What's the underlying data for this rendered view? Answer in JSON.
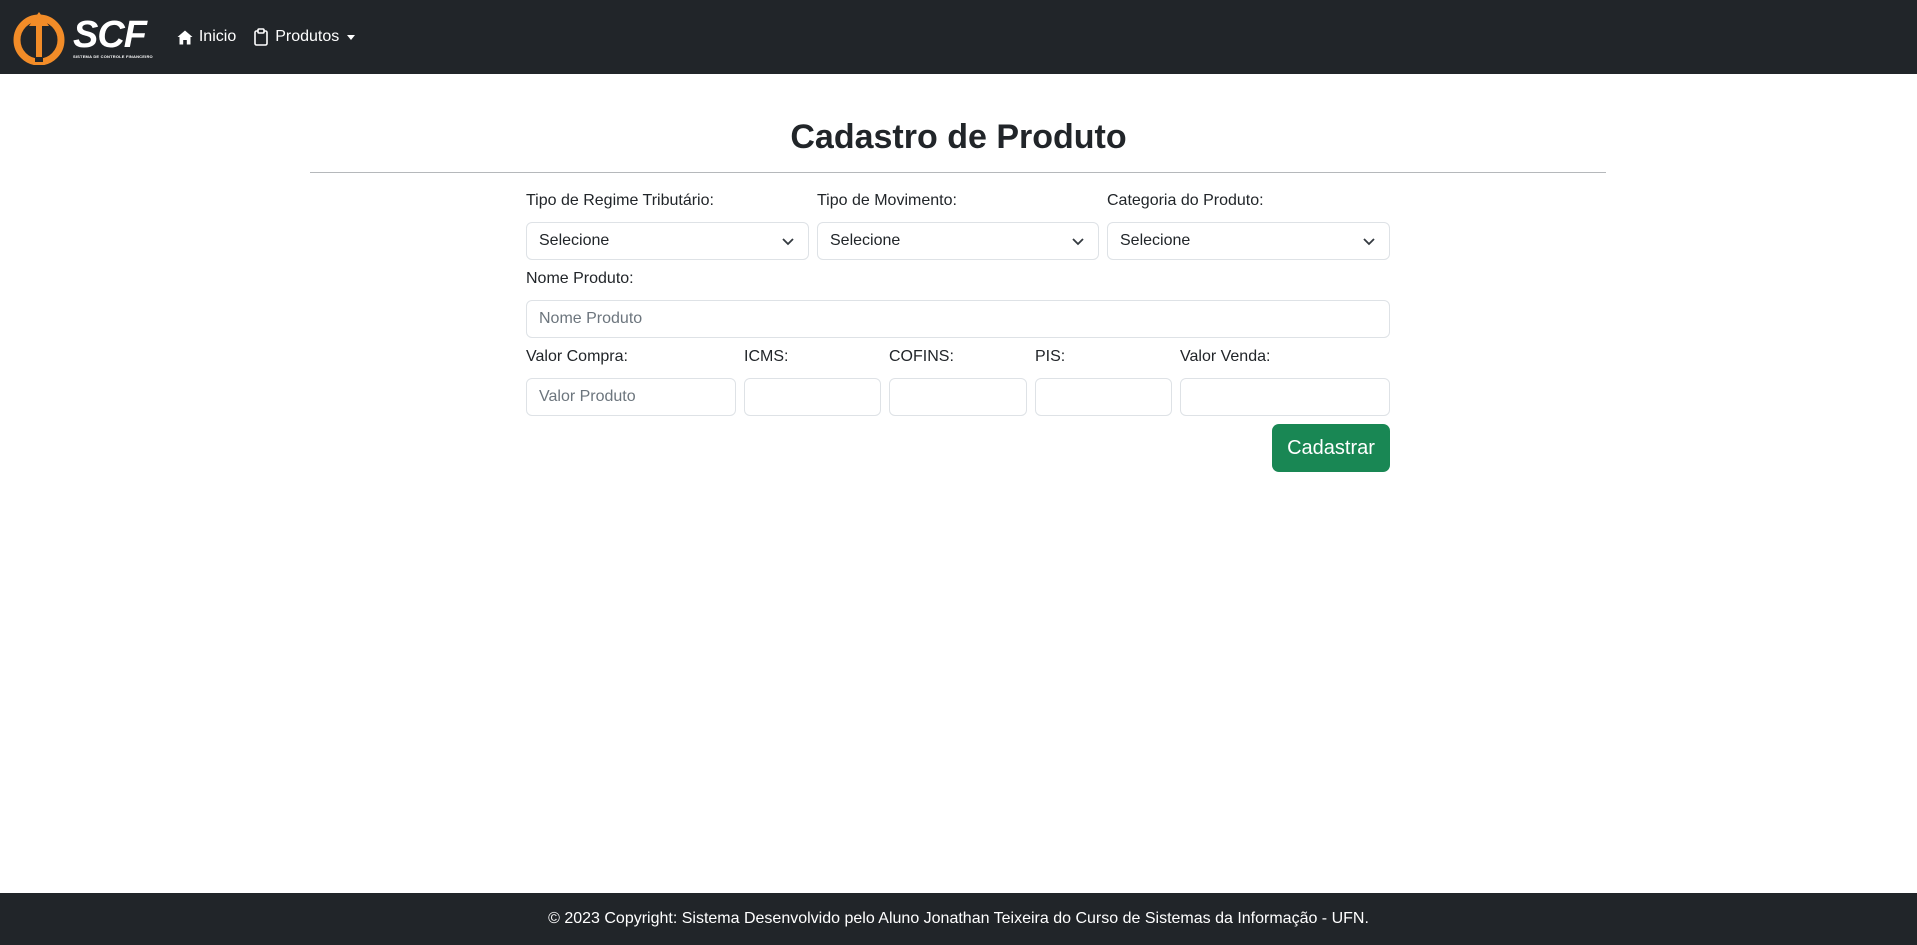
{
  "brand": {
    "name": "SCF",
    "tagline": "SISTEMA DE CONTROLE FINANCEIRO",
    "accent_color": "#f28c28"
  },
  "nav": {
    "home": {
      "label": "Inicio",
      "icon": "home-icon"
    },
    "products": {
      "label": "Produtos",
      "icon": "clipboard-icon"
    }
  },
  "page": {
    "title": "Cadastro de Produto"
  },
  "form": {
    "regime": {
      "label": "Tipo de Regime Tributário:",
      "value": "Selecione"
    },
    "movimento": {
      "label": "Tipo de Movimento:",
      "value": "Selecione"
    },
    "categoria": {
      "label": "Categoria do Produto:",
      "value": "Selecione"
    },
    "nome": {
      "label": "Nome Produto:",
      "placeholder": "Nome Produto",
      "value": ""
    },
    "valor_compra": {
      "label": "Valor Compra:",
      "placeholder": "Valor Produto",
      "value": ""
    },
    "icms": {
      "label": "ICMS:",
      "value": ""
    },
    "cofins": {
      "label": "COFINS:",
      "value": ""
    },
    "pis": {
      "label": "PIS:",
      "value": ""
    },
    "valor_venda": {
      "label": "Valor Venda:",
      "value": ""
    },
    "submit_label": "Cadastrar"
  },
  "footer": {
    "text": "© 2023 Copyright: Sistema Desenvolvido pelo Aluno Jonathan Teixeira do Curso de Sistemas da Informação - UFN."
  },
  "colors": {
    "navbar_bg": "#212529",
    "submit_bg": "#198754",
    "border": "#dee2e6"
  }
}
